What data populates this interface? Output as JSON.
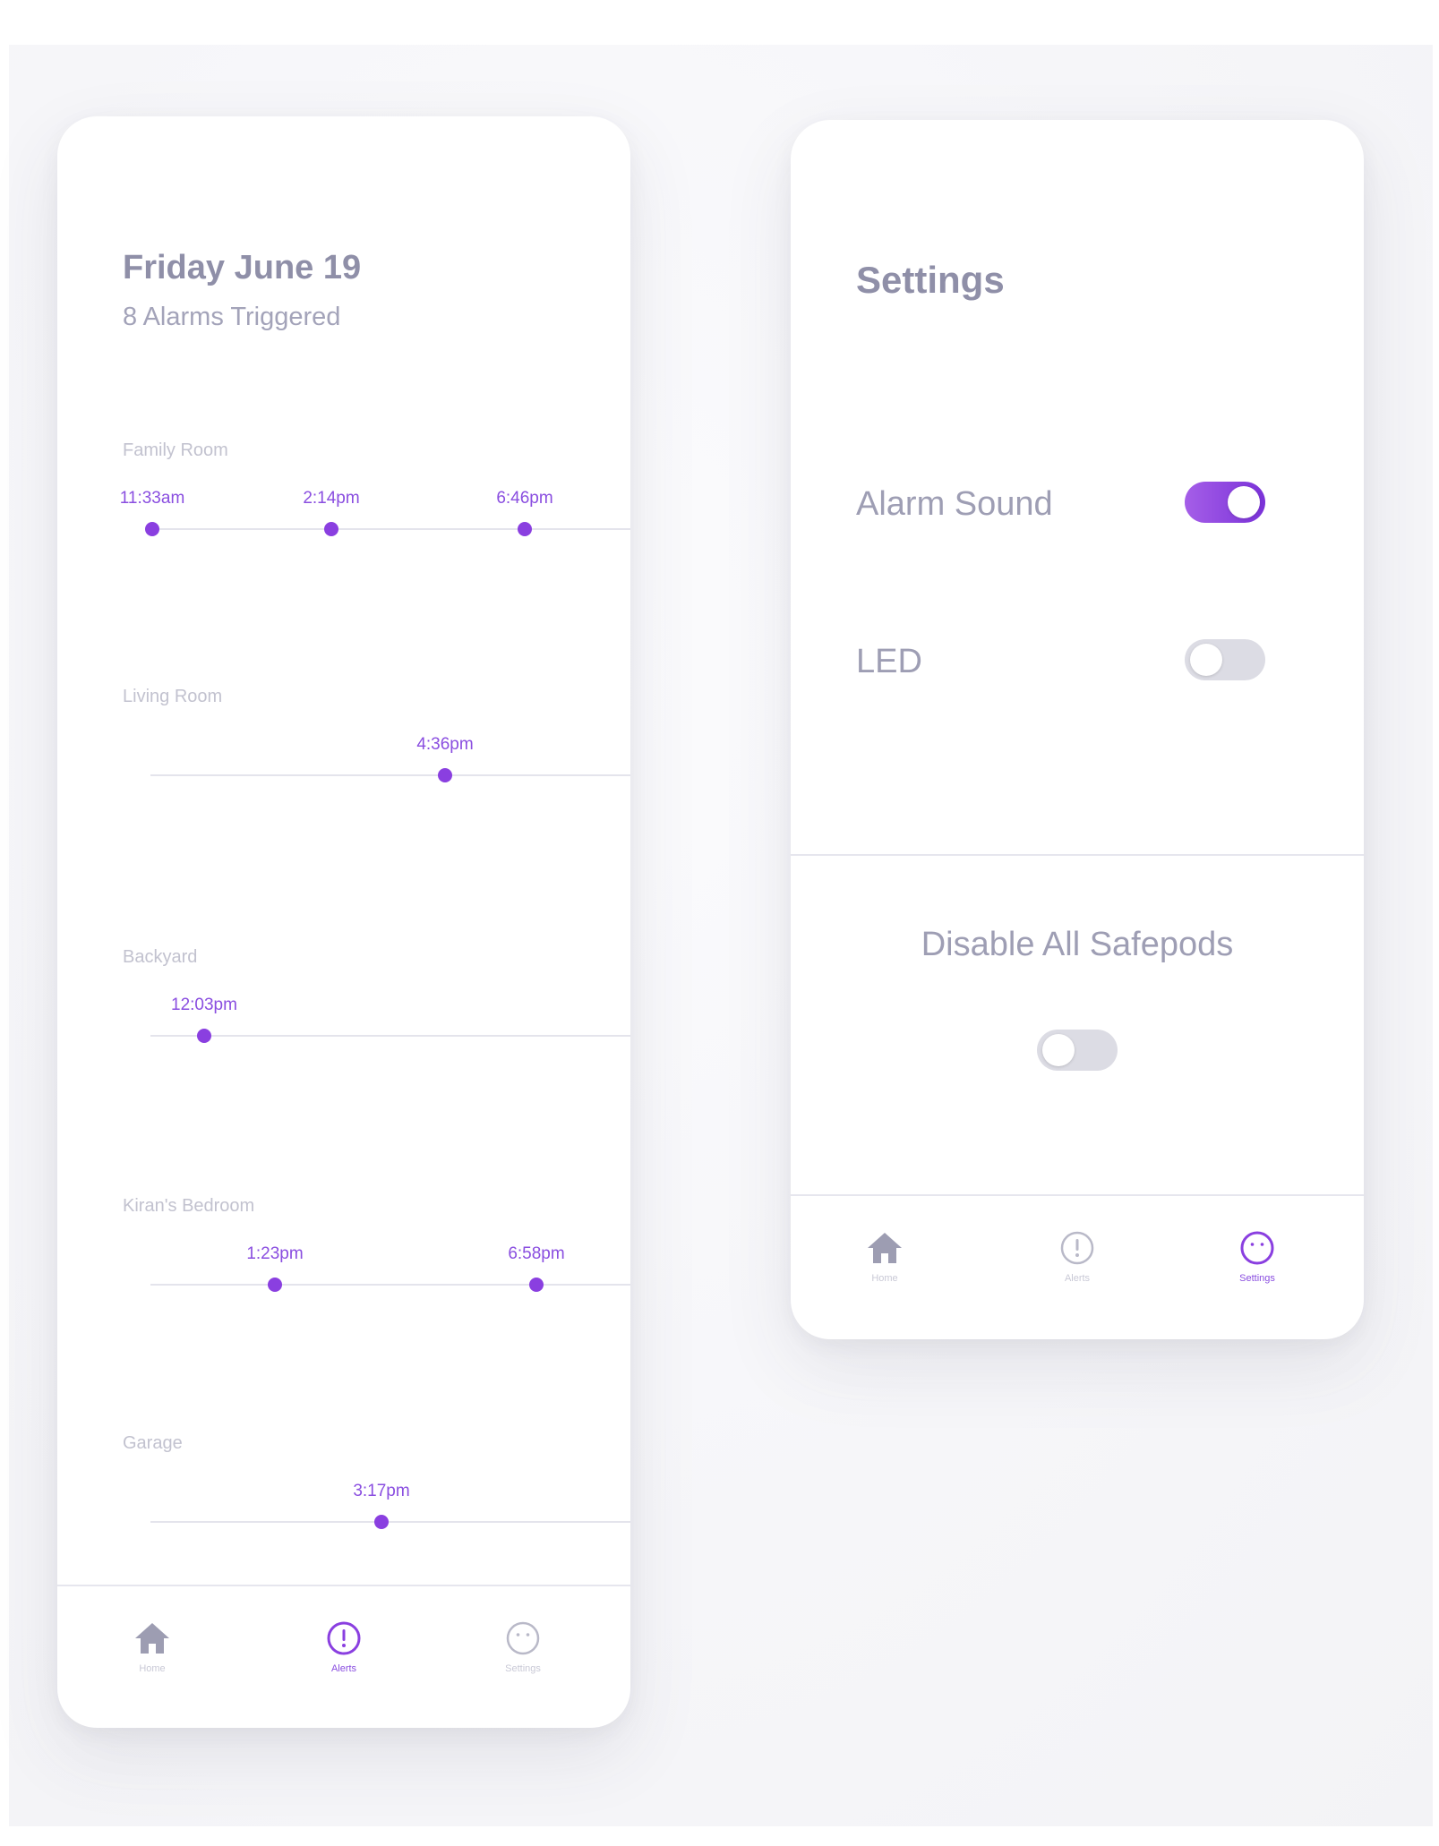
{
  "alerts_screen": {
    "date_title": "Friday June 19",
    "alarm_summary": "8 Alarms Triggered",
    "rooms": [
      {
        "label": "Family Room",
        "alarms": [
          "11:33am",
          "2:14pm",
          "6:46pm"
        ]
      },
      {
        "label": "Living Room",
        "alarms": [
          "4:36pm"
        ]
      },
      {
        "label": "Backyard",
        "alarms": [
          "12:03pm"
        ]
      },
      {
        "label": "Kiran's Bedroom",
        "alarms": [
          "1:23pm",
          "6:58pm"
        ]
      },
      {
        "label": "Garage",
        "alarms": [
          "3:17pm"
        ]
      }
    ],
    "tabbar": {
      "active": "Alerts",
      "tabs": [
        {
          "label": "Home",
          "icon": "home-icon"
        },
        {
          "label": "Alerts",
          "icon": "alert-circle-icon"
        },
        {
          "label": "Settings",
          "icon": "face-icon"
        }
      ]
    }
  },
  "settings_screen": {
    "title": "Settings",
    "alarm_sound": {
      "label": "Alarm Sound",
      "enabled": true
    },
    "led": {
      "label": "LED",
      "enabled": false
    },
    "disable_all": {
      "label": "Disable All Safepods",
      "enabled": false
    },
    "tabbar": {
      "active": "Settings",
      "tabs": [
        {
          "label": "Home",
          "icon": "home-icon"
        },
        {
          "label": "Alerts",
          "icon": "alert-circle-icon"
        },
        {
          "label": "Settings",
          "icon": "face-icon"
        }
      ]
    }
  },
  "colors": {
    "accent": "#8a3fe0",
    "toggle_off": "#dcdce4",
    "heading": "#8f8fa8",
    "muted_label": "#c2c2cf"
  }
}
